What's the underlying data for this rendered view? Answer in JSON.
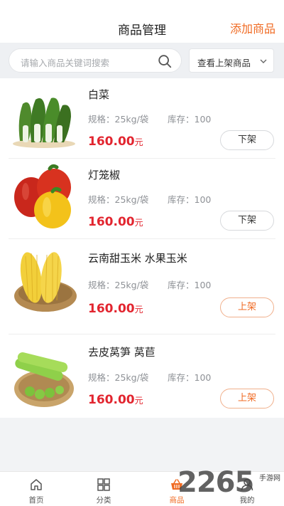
{
  "header": {
    "title": "商品管理",
    "add_label": "添加商品"
  },
  "search": {
    "placeholder": "请输入商品关键词搜索",
    "filter_value": "查看上架商品"
  },
  "products": [
    {
      "name": "白菜",
      "spec": "规格：25kg/袋",
      "stock": "库存：100",
      "price": "160.00",
      "unit": "元",
      "action": "下架"
    },
    {
      "name": "灯笼椒",
      "spec": "规格：25kg/袋",
      "stock": "库存：100",
      "price": "160.00",
      "unit": "元",
      "action": "下架"
    },
    {
      "name": "云南甜玉米 水果玉米",
      "spec": "规格：25kg/袋",
      "stock": "库存：100",
      "price": "160.00",
      "unit": "元",
      "action": "上架"
    },
    {
      "name": "去皮莴笋 莴苣",
      "spec": "规格：25kg/袋",
      "stock": "库存：100",
      "price": "160.00",
      "unit": "元",
      "action": "上架"
    }
  ],
  "tabbar": [
    {
      "label": "首页",
      "icon": "home-icon"
    },
    {
      "label": "分类",
      "icon": "grid-icon"
    },
    {
      "label": "商品",
      "icon": "basket-icon"
    },
    {
      "label": "我的",
      "icon": "user-icon"
    }
  ],
  "watermark": {
    "text": "2265",
    "sub": "手游网"
  },
  "colors": {
    "accent": "#f06a22",
    "price": "#e2252f",
    "page_bg": "#f2f3f5"
  }
}
